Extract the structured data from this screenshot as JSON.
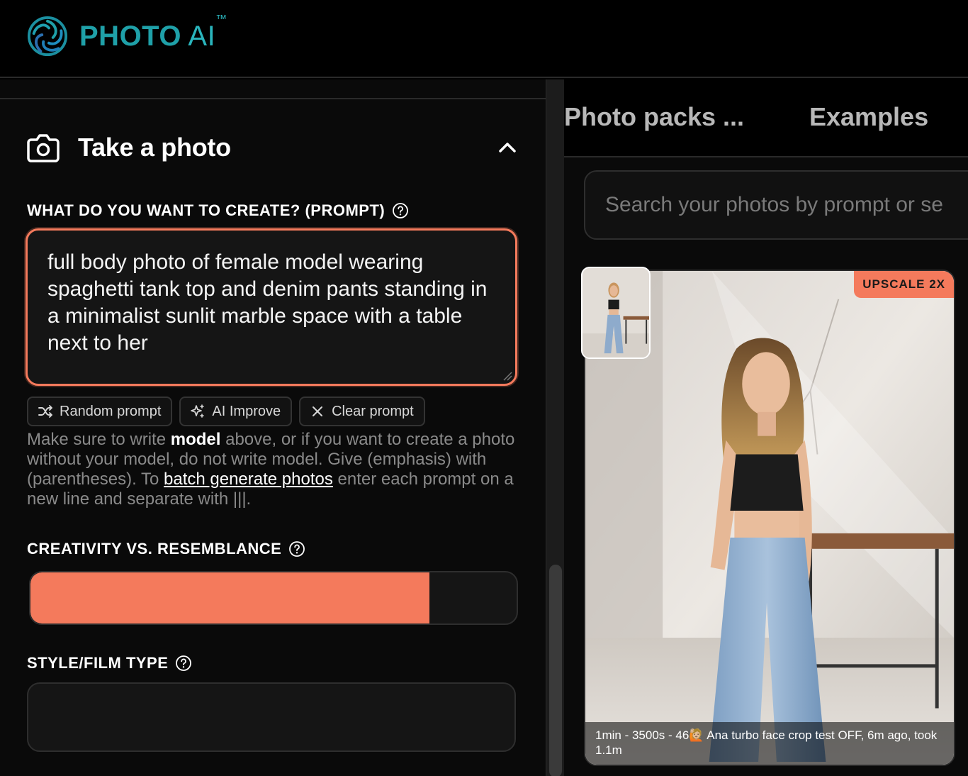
{
  "brand": {
    "name_bold": "PHOTO",
    "name_light": "AI",
    "trademark": "™"
  },
  "panel": {
    "title": "Take a photo",
    "collapse_icon": "chevron-up-icon",
    "camera_icon": "camera-icon"
  },
  "prompt": {
    "label": "WHAT DO YOU WANT TO CREATE? (PROMPT)",
    "value": "full body photo of female model wearing spaghetti tank top and denim pants standing in a minimalist sunlit marble space with a table next to her"
  },
  "prompt_actions": [
    {
      "label": "Random prompt",
      "icon": "shuffle-icon"
    },
    {
      "label": "AI Improve",
      "icon": "sparkles-icon"
    },
    {
      "label": "Clear prompt",
      "icon": "close-icon"
    }
  ],
  "hint": {
    "t1": "Make sure to write ",
    "bold": "model",
    "t2": " above, or if you want to create a photo without your model, do not write model. Give (emphasis) with (parentheses). To ",
    "link": "batch generate photos",
    "t3": " enter each prompt on a new line and separate with |||."
  },
  "creativity": {
    "label": "CREATIVITY VS. RESEMBLANCE",
    "value": 0.82
  },
  "style": {
    "label": "STYLE/FILM TYPE",
    "value": ""
  },
  "tabs": [
    {
      "label": "Photo packs ..."
    },
    {
      "label": "Examples"
    }
  ],
  "search": {
    "placeholder": "Search your photos by prompt or se"
  },
  "photo": {
    "badge": "UPSCALE 2X",
    "caption": "1min - 3500s - 46🙋🏼 Ana turbo face crop test OFF, 6m ago, took 1.1m"
  },
  "colors": {
    "accent": "#f47a5c",
    "brand": "#1fa0a8"
  }
}
